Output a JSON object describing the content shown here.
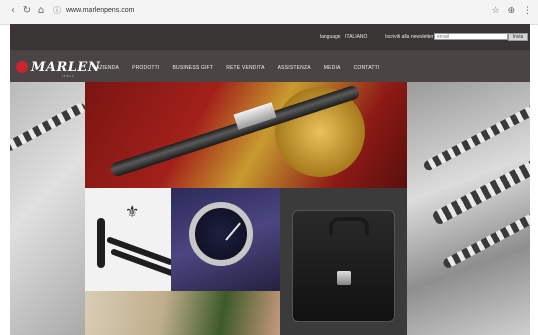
{
  "browser": {
    "url": "www.marlenpens.com",
    "icons": [
      "back-icon",
      "reload-icon",
      "home-icon",
      "info-icon",
      "star-icon",
      "extension-icon",
      "menu-icon"
    ]
  },
  "site": {
    "language_label": "language",
    "language_value": "ITALIANO",
    "newsletter_label": "Iscriviti alla newsletter",
    "email_placeholder": "email",
    "send_label": "Invia",
    "logo_text": "MARLEN",
    "logo_sub": "ITALY",
    "menu": [
      "AZIENDA",
      "PRODOTTI",
      "BUSINESS GIFT",
      "RETE VENDITA",
      "ASSISTENZA",
      "MEDIA",
      "CONTATTI"
    ]
  },
  "colors": {
    "topbar": "#3a3535",
    "menubar": "#4a4444",
    "brand_red": "#c9252c"
  }
}
